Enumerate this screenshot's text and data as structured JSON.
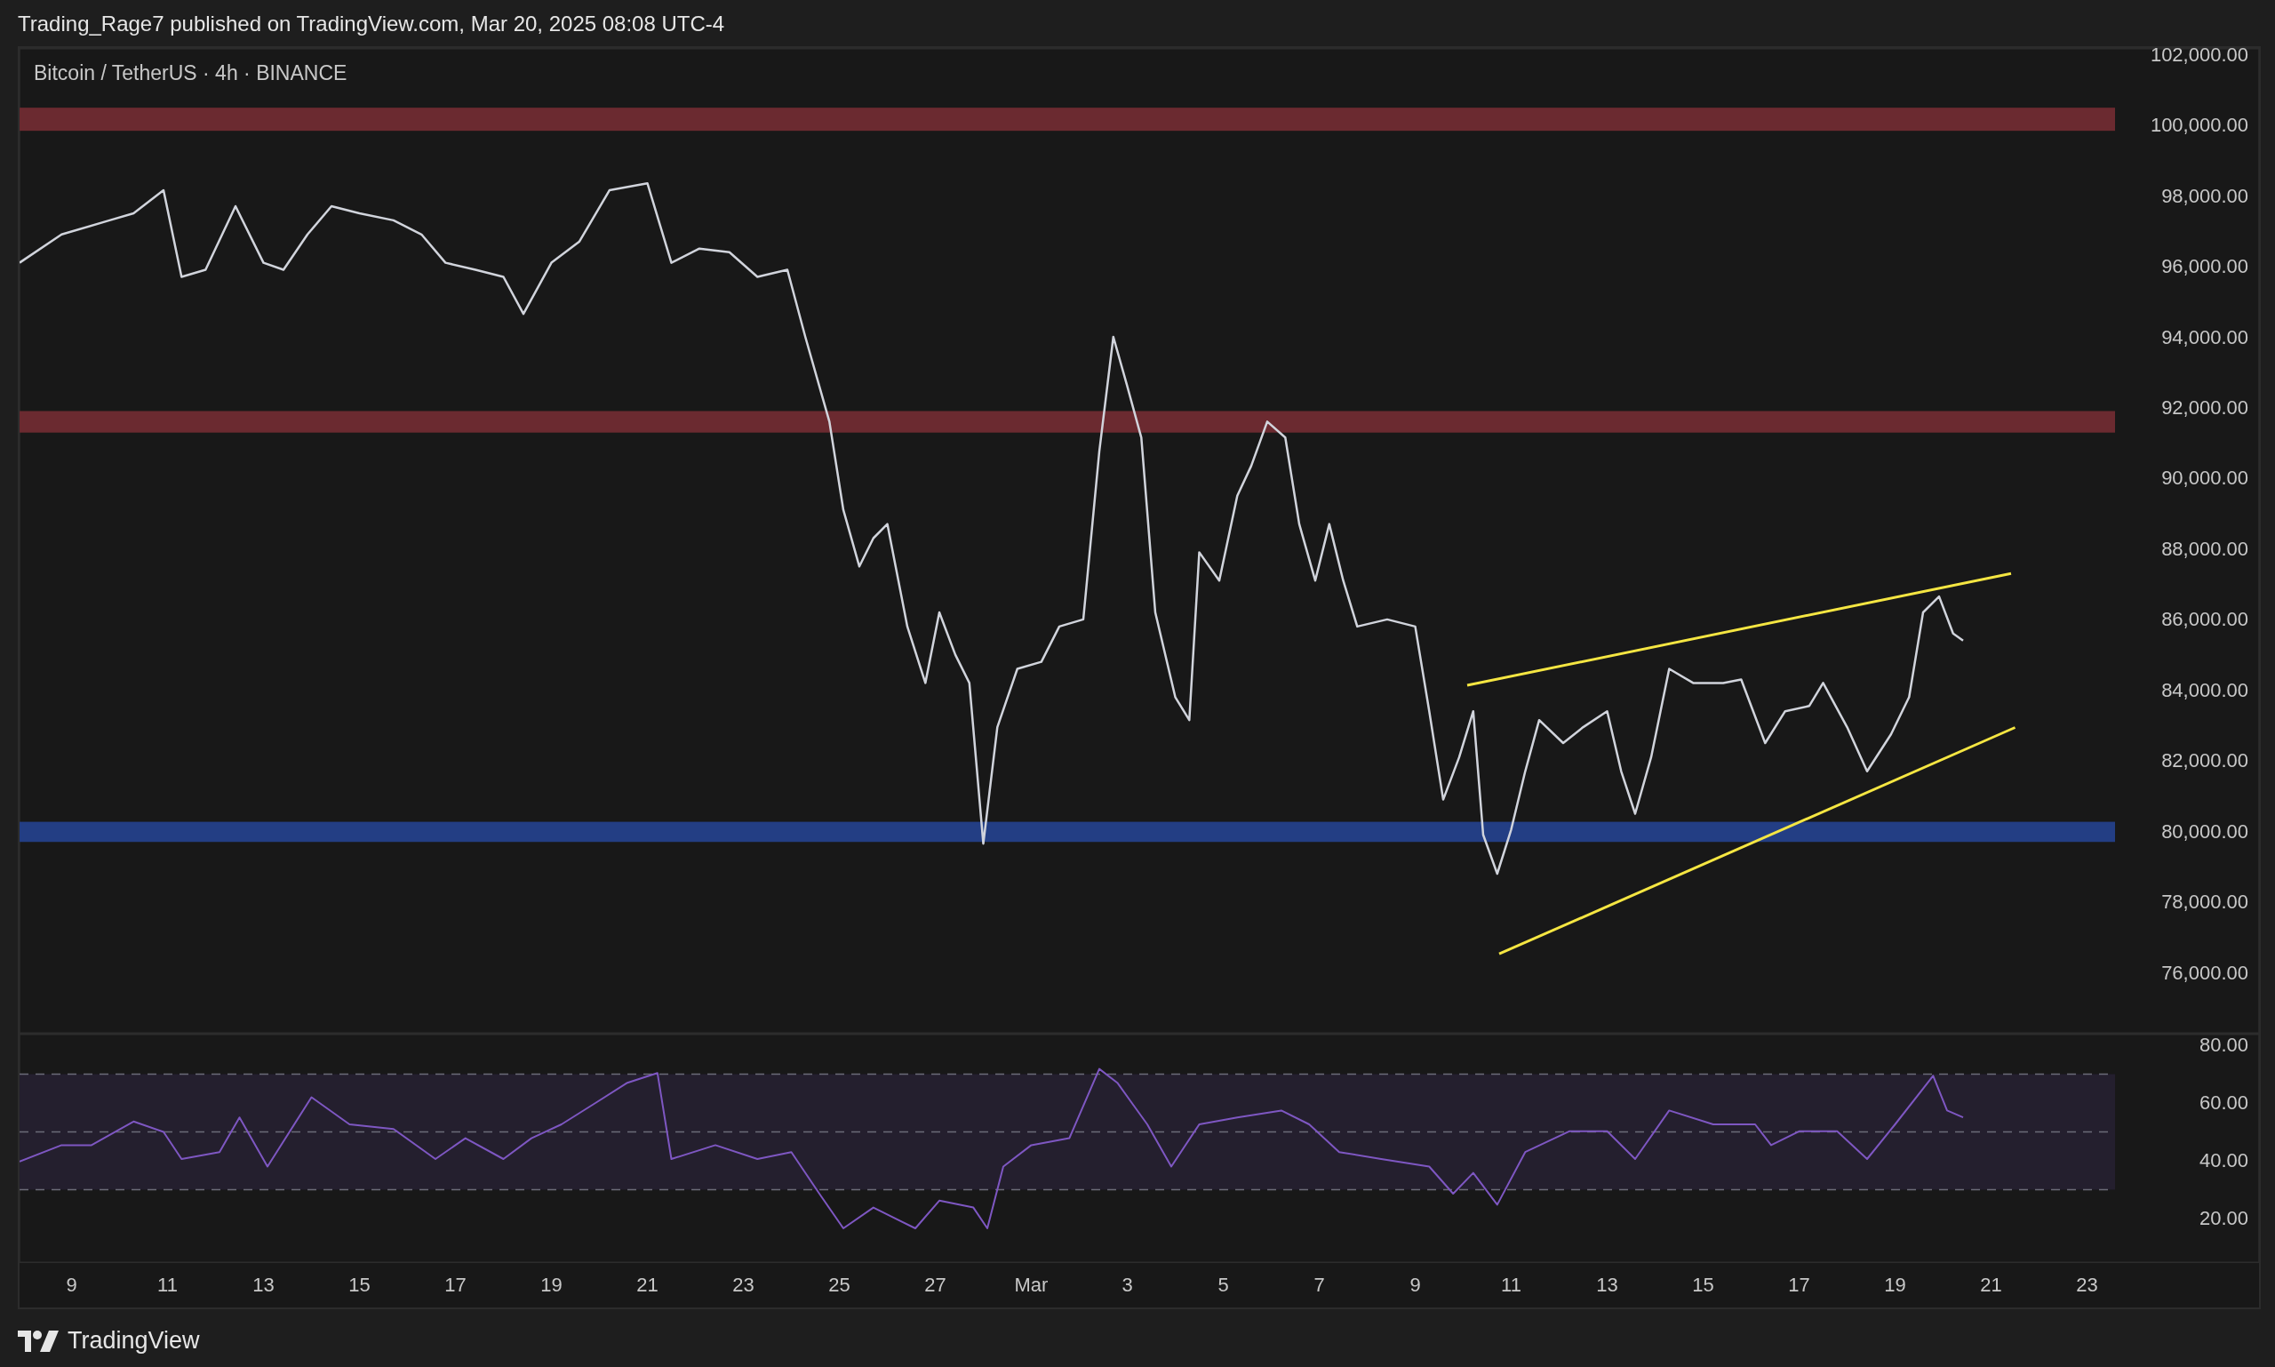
{
  "header": {
    "text": "Trading_Rage7 published on TradingView.com, Mar 20, 2025 08:08 UTC-4"
  },
  "price_pane": {
    "chart_data": {
      "type": "line",
      "title": "Bitcoin / TetherUS · 4h · BINANCE",
      "x": [
        "2025-02-07T22:00",
        "2025-02-08T19:00",
        "2025-02-09T19:00",
        "2025-02-10T07:00",
        "2025-02-10T22:00",
        "2025-02-11T07:00",
        "2025-02-11T19:00",
        "2025-02-12T10:00",
        "2025-02-13T00:00",
        "2025-02-13T10:00",
        "2025-02-13T22:00",
        "2025-02-14T10:00",
        "2025-02-15T00:00",
        "2025-02-15T17:00",
        "2025-02-16T07:00",
        "2025-02-16T19:00",
        "2025-02-17T10:00",
        "2025-02-18T00:00",
        "2025-02-18T10:00",
        "2025-02-19T00:00",
        "2025-02-19T14:00",
        "2025-02-20T05:00",
        "2025-02-21T00:00",
        "2025-02-21T12:00",
        "2025-02-22T02:00",
        "2025-02-22T17:00",
        "2025-02-23T07:00",
        "2025-02-23T22:00",
        "2025-02-24T07:00",
        "2025-02-24T19:00",
        "2025-02-25T02:00",
        "2025-02-25T10:00",
        "2025-02-25T17:00",
        "2025-02-26T00:00",
        "2025-02-26T10:00",
        "2025-02-26T19:00",
        "2025-02-27T02:00",
        "2025-02-27T10:00",
        "2025-02-27T17:00",
        "2025-02-28T00:00",
        "2025-02-28T07:00",
        "2025-02-28T17:00",
        "2025-03-01T05:00",
        "2025-03-01T14:00",
        "2025-03-02T02:00",
        "2025-03-02T10:00",
        "2025-03-02T17:00",
        "2025-03-03T00:00",
        "2025-03-03T07:00",
        "2025-03-03T14:00",
        "2025-03-04T00:00",
        "2025-03-04T07:00",
        "2025-03-04T12:00",
        "2025-03-04T22:00",
        "2025-03-05T07:00",
        "2025-03-05T14:00",
        "2025-03-05T22:00",
        "2025-03-06T07:00",
        "2025-03-06T14:00",
        "2025-03-06T22:00",
        "2025-03-07T05:00",
        "2025-03-07T12:00",
        "2025-03-07T19:00",
        "2025-03-08T10:00",
        "2025-03-09T00:00",
        "2025-03-09T07:00",
        "2025-03-09T14:00",
        "2025-03-09T22:00",
        "2025-03-10T05:00",
        "2025-03-10T10:00",
        "2025-03-10T17:00",
        "2025-03-11T00:00",
        "2025-03-11T07:00",
        "2025-03-11T14:00",
        "2025-03-12T02:00",
        "2025-03-12T12:00",
        "2025-03-13T00:00",
        "2025-03-13T07:00",
        "2025-03-13T14:00",
        "2025-03-13T22:00",
        "2025-03-14T07:00",
        "2025-03-14T19:00",
        "2025-03-15T10:00",
        "2025-03-15T19:00",
        "2025-03-16T07:00",
        "2025-03-16T17:00",
        "2025-03-17T05:00",
        "2025-03-17T12:00",
        "2025-03-18T00:00",
        "2025-03-18T10:00",
        "2025-03-18T22:00",
        "2025-03-19T07:00",
        "2025-03-19T14:00",
        "2025-03-19T22:00",
        "2025-03-20T05:00",
        "2025-03-20T10:00"
      ],
      "series": [
        {
          "color": "#d1d4dc",
          "values": [
            96100,
            96900,
            97300,
            97500,
            98150,
            95700,
            95900,
            97700,
            96100,
            95900,
            96900,
            97700,
            97500,
            97300,
            96900,
            96100,
            95900,
            95700,
            94650,
            96100,
            96700,
            98150,
            98350,
            96100,
            96500,
            96400,
            95700,
            95900,
            94000,
            91600,
            89100,
            87500,
            88300,
            88700,
            85800,
            84200,
            86200,
            85000,
            84200,
            79650,
            82950,
            84600,
            84800,
            85800,
            86000,
            90750,
            94000,
            92600,
            91150,
            86200,
            83800,
            83150,
            87900,
            87100,
            89500,
            90350,
            91600,
            91150,
            88700,
            87100,
            88700,
            87100,
            85800,
            86000,
            85800,
            83400,
            80900,
            82100,
            83400,
            79900,
            78800,
            80050,
            81700,
            83150,
            82500,
            82950,
            83400,
            81700,
            80500,
            82100,
            84600,
            84200,
            84200,
            84300,
            82500,
            83400,
            83550,
            84200,
            82950,
            81700,
            82750,
            83800,
            86200,
            86650,
            85600,
            85400
          ]
        }
      ],
      "xlim": [
        "2025-02-07T22:00",
        "2025-03-26T14:00"
      ],
      "ylim": [
        74270,
        102180
      ],
      "yticks": [
        {
          "value": 76000,
          "label": "76,000.00"
        },
        {
          "value": 78000,
          "label": "78,000.00"
        },
        {
          "value": 80000,
          "label": "80,000.00"
        },
        {
          "value": 82000,
          "label": "82,000.00"
        },
        {
          "value": 84000,
          "label": "84,000.00"
        },
        {
          "value": 86000,
          "label": "86,000.00"
        },
        {
          "value": 88000,
          "label": "88,000.00"
        },
        {
          "value": 90000,
          "label": "90,000.00"
        },
        {
          "value": 92000,
          "label": "92,000.00"
        },
        {
          "value": 94000,
          "label": "94,000.00"
        },
        {
          "value": 96000,
          "label": "96,000.00"
        },
        {
          "value": 98000,
          "label": "98,000.00"
        },
        {
          "value": 100000,
          "label": "100,000.00"
        },
        {
          "value": 102000,
          "label": "102,000.00"
        }
      ],
      "bands": [
        {
          "axis": "y",
          "from": 99835,
          "to": 100490,
          "color": "#6b2a30"
        },
        {
          "axis": "y",
          "from": 91290,
          "to": 91900,
          "color": "#6b2a30"
        },
        {
          "axis": "y",
          "from": 79700,
          "to": 80270,
          "color": "#233e84"
        }
      ]
    }
  },
  "rsi_pane": {
    "chart_data": {
      "type": "line",
      "x": [
        "2025-02-07T22:00",
        "2025-02-08T19:00",
        "2025-02-09T10:00",
        "2025-02-10T07:00",
        "2025-02-10T22:00",
        "2025-02-11T07:00",
        "2025-02-12T02:00",
        "2025-02-12T12:00",
        "2025-02-13T02:00",
        "2025-02-14T00:00",
        "2025-02-14T19:00",
        "2025-02-15T17:00",
        "2025-02-16T14:00",
        "2025-02-17T05:00",
        "2025-02-18T00:00",
        "2025-02-18T14:00",
        "2025-02-19T05:00",
        "2025-02-19T22:00",
        "2025-02-20T14:00",
        "2025-02-21T05:00",
        "2025-02-21T12:00",
        "2025-02-22T10:00",
        "2025-02-23T07:00",
        "2025-02-24T00:00",
        "2025-02-24T14:00",
        "2025-02-25T02:00",
        "2025-02-25T17:00",
        "2025-02-26T14:00",
        "2025-02-27T02:00",
        "2025-02-27T19:00",
        "2025-02-28T02:00",
        "2025-02-28T10:00",
        "2025-03-01T00:00",
        "2025-03-01T19:00",
        "2025-03-02T10:00",
        "2025-03-02T19:00",
        "2025-03-03T10:00",
        "2025-03-03T22:00",
        "2025-03-04T12:00",
        "2025-03-05T07:00",
        "2025-03-06T05:00",
        "2025-03-06T19:00",
        "2025-03-07T10:00",
        "2025-03-08T07:00",
        "2025-03-09T07:00",
        "2025-03-09T19:00",
        "2025-03-10T05:00",
        "2025-03-10T17:00",
        "2025-03-11T07:00",
        "2025-03-12T05:00",
        "2025-03-13T00:00",
        "2025-03-13T14:00",
        "2025-03-14T07:00",
        "2025-03-15T05:00",
        "2025-03-16T02:00",
        "2025-03-16T10:00",
        "2025-03-17T00:00",
        "2025-03-17T19:00",
        "2025-03-18T10:00",
        "2025-03-19T00:00",
        "2025-03-19T19:00",
        "2025-03-20T02:00",
        "2025-03-20T10:00"
      ],
      "series": [
        {
          "color": "#7e57c2",
          "values": [
            39.7,
            45.4,
            45.4,
            53.6,
            50,
            40.6,
            43,
            55,
            38,
            62,
            52.6,
            51,
            40.6,
            47.8,
            40.6,
            47.8,
            52.6,
            60,
            67,
            70.4,
            40.6,
            45.4,
            40.6,
            43,
            28.6,
            16.6,
            23.8,
            16.6,
            26.2,
            23.8,
            16.6,
            38,
            45.4,
            47.8,
            71.8,
            67,
            52.6,
            38,
            52.6,
            55,
            57.4,
            52.6,
            43,
            40.6,
            38,
            28.6,
            35.8,
            24.8,
            43,
            50.2,
            50.2,
            40.6,
            57.4,
            52.6,
            52.6,
            45.4,
            50.2,
            50.2,
            40.6,
            52.6,
            69.4,
            57.4,
            55
          ]
        }
      ],
      "xlim": [
        "2025-02-07T22:00",
        "2025-03-26T14:00"
      ],
      "ylim": [
        4.6,
        84
      ],
      "xticks": [
        {
          "value": "2025-02-09T00:00",
          "label": "9"
        },
        {
          "value": "2025-02-11T00:00",
          "label": "11"
        },
        {
          "value": "2025-02-13T00:00",
          "label": "13"
        },
        {
          "value": "2025-02-15T00:00",
          "label": "15"
        },
        {
          "value": "2025-02-17T00:00",
          "label": "17"
        },
        {
          "value": "2025-02-19T00:00",
          "label": "19"
        },
        {
          "value": "2025-02-21T00:00",
          "label": "21"
        },
        {
          "value": "2025-02-23T00:00",
          "label": "23"
        },
        {
          "value": "2025-02-25T00:00",
          "label": "25"
        },
        {
          "value": "2025-02-27T00:00",
          "label": "27"
        },
        {
          "value": "2025-03-01T00:00",
          "label": "Mar"
        },
        {
          "value": "2025-03-03T00:00",
          "label": "3"
        },
        {
          "value": "2025-03-05T00:00",
          "label": "5"
        },
        {
          "value": "2025-03-07T00:00",
          "label": "7"
        },
        {
          "value": "2025-03-09T00:00",
          "label": "9"
        },
        {
          "value": "2025-03-11T00:00",
          "label": "11"
        },
        {
          "value": "2025-03-13T00:00",
          "label": "13"
        },
        {
          "value": "2025-03-15T00:00",
          "label": "15"
        },
        {
          "value": "2025-03-17T00:00",
          "label": "17"
        },
        {
          "value": "2025-03-19T00:00",
          "label": "19"
        },
        {
          "value": "2025-03-21T00:00",
          "label": "21"
        },
        {
          "value": "2025-03-23T00:00",
          "label": "23"
        }
      ],
      "yticks": [
        {
          "value": 20,
          "label": "20.00"
        },
        {
          "value": 40,
          "label": "40.00"
        },
        {
          "value": 60,
          "label": "60.00"
        },
        {
          "value": 80,
          "label": "80.00"
        }
      ],
      "bands": [
        {
          "axis": "y",
          "from": 30,
          "to": 70,
          "color": "#241f2e"
        }
      ],
      "ref_lines": [
        {
          "axis": "y",
          "value": 70
        },
        {
          "axis": "y",
          "value": 50
        },
        {
          "axis": "y",
          "value": 30
        }
      ]
    }
  },
  "footer": {
    "brand": "TradingView"
  }
}
